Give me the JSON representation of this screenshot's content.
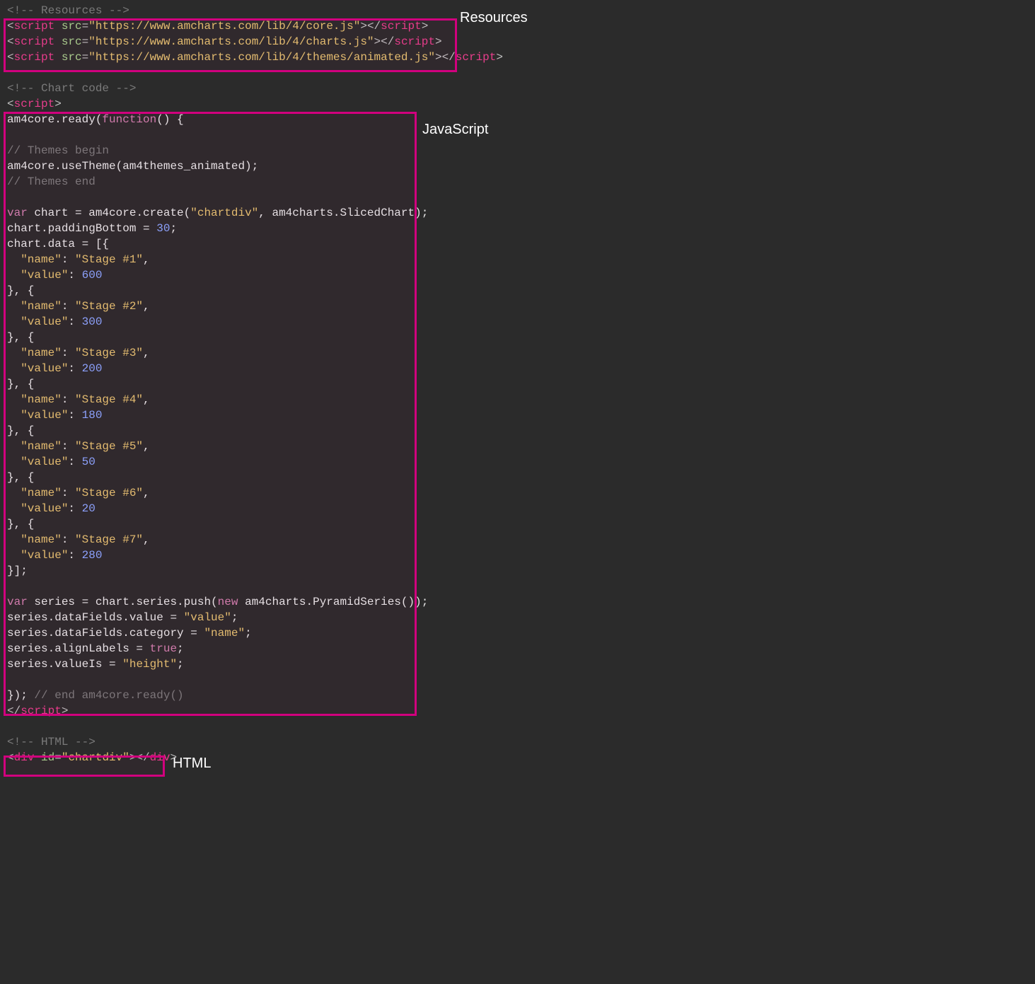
{
  "labels": {
    "resources": "Resources",
    "javascript": "JavaScript",
    "html": "HTML"
  },
  "code": {
    "resources_comment": "<!-- Resources -->",
    "resource_srcs": [
      "https://www.amcharts.com/lib/4/core.js",
      "https://www.amcharts.com/lib/4/charts.js",
      "https://www.amcharts.com/lib/4/themes/animated.js"
    ],
    "chart_code_comment": "<!-- Chart code -->",
    "js_lines": {
      "ready_open": "am4core.ready(",
      "function_kw": "function",
      "ready_open_tail": "() {",
      "themes_begin": "// Themes begin",
      "use_theme": "am4core.useTheme(am4themes_animated);",
      "themes_end": "// Themes end",
      "var_chart_a": "var",
      "var_chart_b": " chart = am4core.create(",
      "chartdiv_str": "\"chartdiv\"",
      "var_chart_c": ", am4charts.SlicedChart);",
      "padding_a": "chart.paddingBottom = ",
      "padding_num": "30",
      "padding_b": ";",
      "data_open": "chart.data = [{",
      "data_close": "}];",
      "series_a": "var",
      "series_b": " series = chart.series.push(",
      "series_new": "new",
      "series_c": " am4charts.PyramidSeries());",
      "sdf_value": "series.dataFields.value = ",
      "sdf_value_str": "\"value\"",
      "sdf_cat": "series.dataFields.category = ",
      "sdf_cat_str": "\"name\"",
      "align": "series.alignLabels = ",
      "align_true": "true",
      "valueIs": "series.valueIs = ",
      "valueIs_str": "\"height\"",
      "close": "}); ",
      "close_comment": "// end am4core.ready()"
    },
    "data_entries": [
      {
        "name": "\"Stage #1\"",
        "value": "600"
      },
      {
        "name": "\"Stage #2\"",
        "value": "300"
      },
      {
        "name": "\"Stage #3\"",
        "value": "200"
      },
      {
        "name": "\"Stage #4\"",
        "value": "180"
      },
      {
        "name": "\"Stage #5\"",
        "value": "50"
      },
      {
        "name": "\"Stage #6\"",
        "value": "20"
      },
      {
        "name": "\"Stage #7\"",
        "value": "280"
      }
    ],
    "html_comment": "<!-- HTML -->",
    "html_div_id": "\"chartdiv\""
  },
  "tokens": {
    "script": "script",
    "div": "div",
    "src": "src",
    "id": "id",
    "lt": "<",
    "gt": ">",
    "lt_slash": "</",
    "eq": "=",
    "semi": ";",
    "name_key": "\"name\"",
    "value_key": "\"value\"",
    "colon": ": ",
    "comma": ",",
    "obj_sep": "}, {"
  }
}
